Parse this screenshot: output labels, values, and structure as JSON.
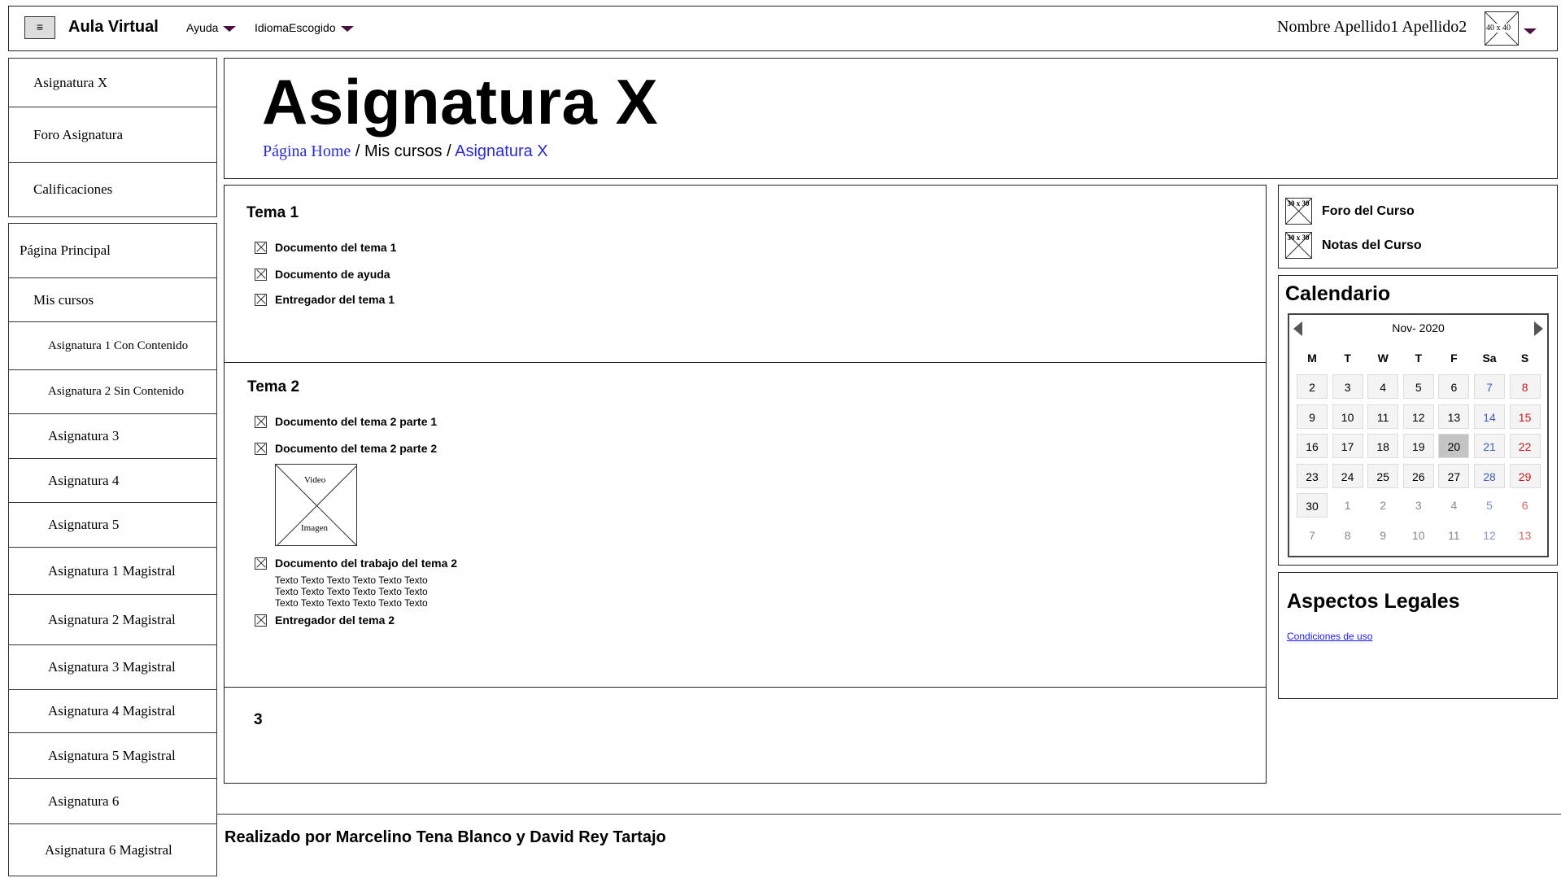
{
  "header": {
    "menu_icon": "≡",
    "app_title": "Aula Virtual",
    "help_label": "Ayuda",
    "language_label": "IdiomaEscogido",
    "user_name": "Nombre Apellido1 Apellido2",
    "avatar_label": "40 x 40"
  },
  "sidebar": {
    "course_items": [
      "Asignatura X",
      "Foro Asignatura",
      "Calificaciones"
    ],
    "main_page": "Página Principal",
    "my_courses": "Mis cursos",
    "courses": [
      "Asignatura 1 Con Contenido",
      "Asignatura 2 Sin Contenido",
      "Asignatura 3",
      "Asignatura 4",
      "Asignatura 5",
      "Asignatura 1 Magistral",
      "Asignatura 2 Magistral",
      "Asignatura 3 Magistral",
      "Asignatura 4 Magistral",
      "Asignatura 5 Magistral",
      "Asignatura 6",
      "Asignatura 6 Magistral"
    ]
  },
  "course": {
    "title": "Asignatura X",
    "breadcrumb": {
      "home": "Página Home",
      "sep1": "/ Mis cursos /",
      "current": "Asignatura X"
    }
  },
  "sections": {
    "tema1": {
      "title": "Tema 1",
      "docs": [
        "Documento del tema 1",
        "Documento de ayuda",
        "Entregador del tema 1"
      ]
    },
    "tema2": {
      "title": "Tema 2",
      "docs": [
        "Documento del tema 2 parte 1",
        "Documento del tema 2 parte 2"
      ],
      "video_label_top": "Video",
      "video_label_bottom": "Imagen",
      "work_doc": "Documento del trabajo del tema 2",
      "work_text": [
        "Texto Texto Texto Texto Texto Texto",
        "Texto Texto Texto Texto Texto Texto",
        "Texto Texto Texto Texto Texto Texto"
      ],
      "deliver": "Entregador del tema 2"
    },
    "tema3": {
      "title": "3"
    }
  },
  "right": {
    "links": [
      {
        "icon": "image-placeholder-icon",
        "ph": "30 x 30",
        "label": "Foro del Curso"
      },
      {
        "icon": "image-placeholder-icon",
        "ph": "30 x 30",
        "label": "Notas del Curso"
      }
    ],
    "calendar": {
      "title": "Calendario",
      "month": "Nov- 2020",
      "weekdays": [
        "M",
        "T",
        "W",
        "T",
        "F",
        "Sa",
        "S"
      ],
      "today": "20",
      "weeks": [
        [
          "2",
          "3",
          "4",
          "5",
          "6",
          "7",
          "8"
        ],
        [
          "9",
          "10",
          "11",
          "12",
          "13",
          "14",
          "15"
        ],
        [
          "16",
          "17",
          "18",
          "19",
          "20",
          "21",
          "22"
        ],
        [
          "23",
          "24",
          "25",
          "26",
          "27",
          "28",
          "29"
        ],
        [
          "30",
          "1",
          "2",
          "3",
          "4",
          "5",
          "6"
        ],
        [
          "7",
          "8",
          "9",
          "10",
          "11",
          "12",
          "13"
        ]
      ],
      "colors": {
        "saturday": "#4060b0",
        "sunday": "#c81a1a",
        "muted": "#888888"
      }
    },
    "legal": {
      "title": "Aspectos Legales",
      "link": "Condiciones de uso"
    }
  },
  "footer": {
    "text": "Realizado por Marcelino Tena Blanco y David Rey Tartajo"
  }
}
